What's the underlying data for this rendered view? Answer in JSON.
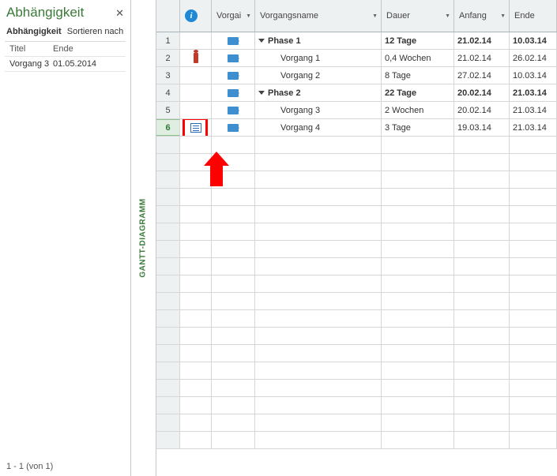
{
  "leftPanel": {
    "title": "Abhängigkeit",
    "subLabel": "Abhängigkeit",
    "sortLabel": "Sortieren nach",
    "colTitel": "Titel",
    "colEnde": "Ende",
    "itemTitel": "Vorgang 3",
    "itemEnde": "01.05.2014",
    "footer": "1 - 1 (von 1)"
  },
  "vertLabel": "GANTT-DIAGRAMM",
  "columns": {
    "vorgar": "Vorgai",
    "name": "Vorgangsname",
    "dauer": "Dauer",
    "anfang": "Anfang",
    "ende": "Ende"
  },
  "rows": [
    {
      "num": "1",
      "info": "",
      "name": "Phase 1",
      "indent": false,
      "bold": true,
      "tri": true,
      "dauer": "12 Tage",
      "anfang": "21.02.14",
      "ende": "10.03.14"
    },
    {
      "num": "2",
      "info": "person",
      "name": "Vorgang 1",
      "indent": true,
      "bold": false,
      "tri": false,
      "dauer": "0,4 Wochen",
      "anfang": "21.02.14",
      "ende": "26.02.14"
    },
    {
      "num": "3",
      "info": "",
      "name": "Vorgang 2",
      "indent": true,
      "bold": false,
      "tri": false,
      "dauer": "8 Tage",
      "anfang": "27.02.14",
      "ende": "10.03.14"
    },
    {
      "num": "4",
      "info": "",
      "name": "Phase 2",
      "indent": false,
      "bold": true,
      "tri": true,
      "dauer": "22 Tage",
      "anfang": "20.02.14",
      "ende": "21.03.14"
    },
    {
      "num": "5",
      "info": "",
      "name": "Vorgang 3",
      "indent": true,
      "bold": false,
      "tri": false,
      "dauer": "2 Wochen",
      "anfang": "20.02.14",
      "ende": "21.03.14"
    },
    {
      "num": "6",
      "info": "notes",
      "name": "Vorgang 4",
      "indent": true,
      "bold": false,
      "tri": false,
      "dauer": "3 Tage",
      "anfang": "19.03.14",
      "ende": "21.03.14",
      "selected": true
    }
  ]
}
